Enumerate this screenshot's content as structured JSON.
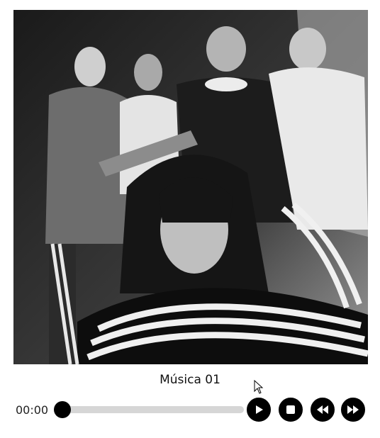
{
  "player": {
    "cover": {
      "description_icon": "album-cover-image"
    },
    "song_title": "Música 01",
    "current_time": "00:00",
    "progress": 0,
    "buttons": {
      "play": "play-icon",
      "stop": "stop-icon",
      "previous": "rewind-icon",
      "next": "fast-forward-icon"
    }
  },
  "colors": {
    "background": "#ffffff",
    "controls": "#000000",
    "track": "#d6d6d6",
    "text": "#111111"
  }
}
